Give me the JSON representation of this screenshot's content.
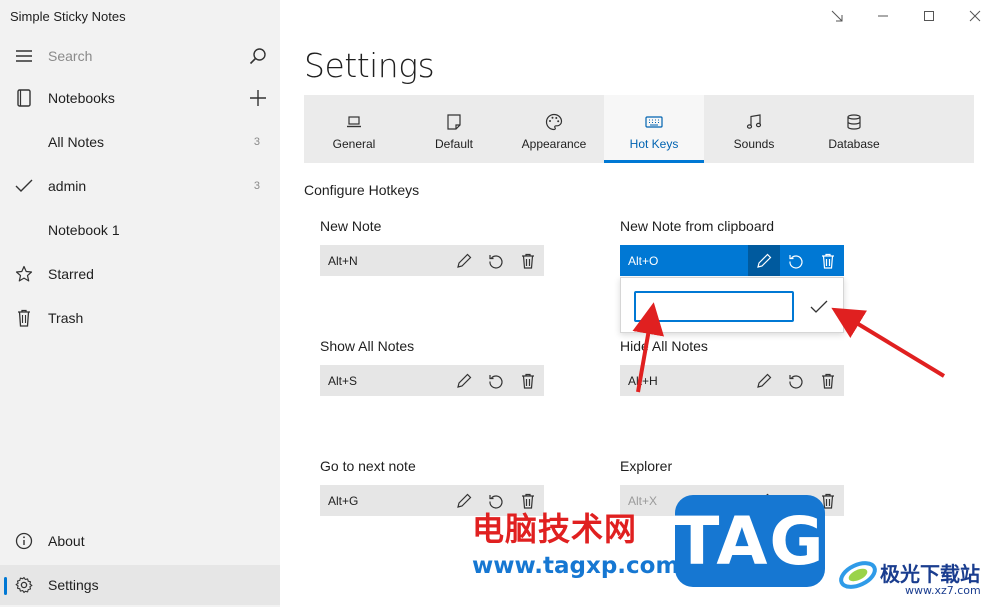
{
  "app": {
    "title": "Simple Sticky Notes"
  },
  "sidebar": {
    "search_placeholder": "Search",
    "notebooks_label": "Notebooks",
    "items": [
      {
        "label": "All Notes",
        "count": "3"
      },
      {
        "label": "admin",
        "count": "3"
      },
      {
        "label": "Notebook 1",
        "count": ""
      },
      {
        "label": "Starred",
        "count": ""
      },
      {
        "label": "Trash",
        "count": ""
      }
    ],
    "about_label": "About",
    "settings_label": "Settings"
  },
  "page": {
    "title": "Settings"
  },
  "tabs": [
    {
      "label": "General",
      "icon": "laptop-icon"
    },
    {
      "label": "Default",
      "icon": "note-icon"
    },
    {
      "label": "Appearance",
      "icon": "palette-icon"
    },
    {
      "label": "Hot Keys",
      "icon": "keyboard-icon",
      "active": true
    },
    {
      "label": "Sounds",
      "icon": "music-icon"
    },
    {
      "label": "Database",
      "icon": "database-icon"
    }
  ],
  "hotkeys": {
    "section_title": "Configure Hotkeys",
    "items": [
      {
        "label": "New Note",
        "value": "Alt+N"
      },
      {
        "label": "New Note from clipboard",
        "value": "Alt+O"
      },
      {
        "label": "Show All Notes",
        "value": "Alt+S"
      },
      {
        "label": "Hide All Notes",
        "value": "Alt+H"
      },
      {
        "label": "Go to next note",
        "value": "Alt+G"
      },
      {
        "label": "Explorer",
        "value": "Alt+X"
      }
    ],
    "popup_input_value": ""
  },
  "watermark": {
    "cn_text": "电脑技术网",
    "url": "www.tagxp.com",
    "tag": "TAG",
    "site_cn": "极光下载站",
    "site_url": "www.xz7.com"
  },
  "colors": {
    "accent": "#0078d4",
    "arrow": "#e02020",
    "sidebar_bg": "#f2f2f2",
    "tabs_bg": "#ebebeb"
  }
}
